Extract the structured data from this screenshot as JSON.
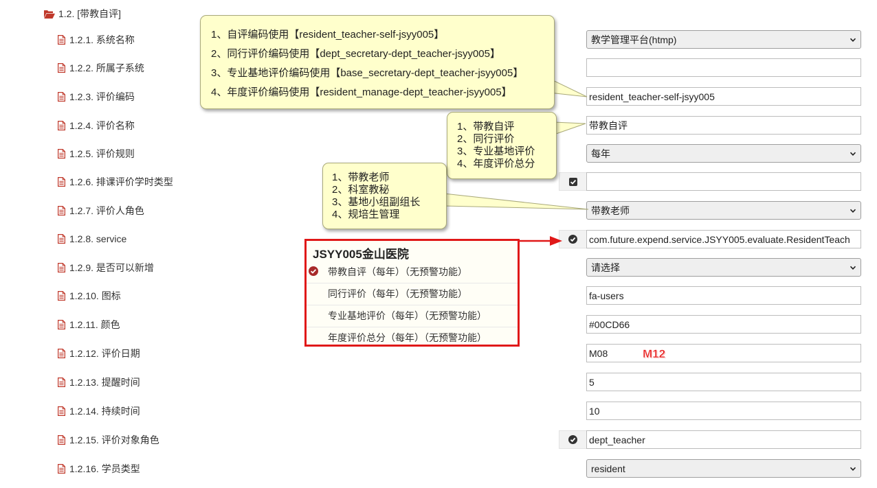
{
  "section": {
    "title": "1.2. [带教自评]"
  },
  "rows": [
    {
      "label": "1.2.1. 系统名称",
      "type": "select",
      "value": "教学管理平台(htmp)"
    },
    {
      "label": "1.2.2. 所属子系统",
      "type": "input",
      "value": ""
    },
    {
      "label": "1.2.3. 评价编码",
      "type": "input",
      "value": "resident_teacher-self-jsyy005"
    },
    {
      "label": "1.2.4. 评价名称",
      "type": "input",
      "value": "带教自评"
    },
    {
      "label": "1.2.5. 评价规则",
      "type": "select",
      "value": "每年"
    },
    {
      "label": "1.2.6. 排课评价学时类型",
      "type": "input",
      "value": ""
    },
    {
      "label": "1.2.7. 评价人角色",
      "type": "select",
      "value": "带教老师"
    },
    {
      "label": "1.2.8. service",
      "type": "input",
      "value": "com.future.expend.service.JSYY005.evaluate.ResidentTeach"
    },
    {
      "label": "1.2.9. 是否可以新增",
      "type": "select",
      "value": "请选择"
    },
    {
      "label": "1.2.10. 图标",
      "type": "input",
      "value": "fa-users"
    },
    {
      "label": "1.2.11. 颜色",
      "type": "input",
      "value": "#00CD66"
    },
    {
      "label": "1.2.12. 评价日期",
      "type": "input",
      "value": "M08"
    },
    {
      "label": "1.2.13. 提醒时间",
      "type": "input",
      "value": "5"
    },
    {
      "label": "1.2.14. 持续时间",
      "type": "input",
      "value": "10"
    },
    {
      "label": "1.2.15. 评价对象角色",
      "type": "input",
      "value": "dept_teacher"
    },
    {
      "label": "1.2.16. 学员类型",
      "type": "select",
      "value": "resident"
    }
  ],
  "callouts": {
    "code_hint": [
      "1、自评编码使用【resident_teacher-self-jsyy005】",
      "2、同行评价编码使用【dept_secretary-dept_teacher-jsyy005】",
      "3、专业基地评价编码使用【base_secretary-dept_teacher-jsyy005】",
      "4、年度评价编码使用【resident_manage-dept_teacher-jsyy005】"
    ],
    "name_hint": [
      "1、带教自评",
      "2、同行评价",
      "3、专业基地评价",
      "4、年度评价总分"
    ],
    "role_hint": [
      "1、带教老师",
      "2、科室教秘",
      "3、基地小组副组长",
      "4、规培生管理"
    ]
  },
  "hospital_box": {
    "title": "JSYY005金山医院",
    "items": [
      {
        "label": "带教自评（每年）（无预警功能）",
        "selected": true
      },
      {
        "label": "同行评价（每年）（无预警功能）",
        "selected": false
      },
      {
        "label": "专业基地评价（每年）（无预警功能）",
        "selected": false
      },
      {
        "label": "年度评价总分（每年）（无预警功能）",
        "selected": false
      }
    ]
  },
  "annotation": {
    "m12": "M12"
  },
  "colors": {
    "callout_bg": "#ffffcc",
    "highlight_border": "#e01818",
    "file_icon": "#c0392b",
    "folder_icon": "#c0392b",
    "check_icon": "#333333"
  },
  "icons": {
    "section": "folder-open-icon",
    "row": "file-text-icon",
    "checked_addon": "check-square-icon",
    "selected_item": "check-circle-icon",
    "select_caret": "chevron-down-icon"
  }
}
